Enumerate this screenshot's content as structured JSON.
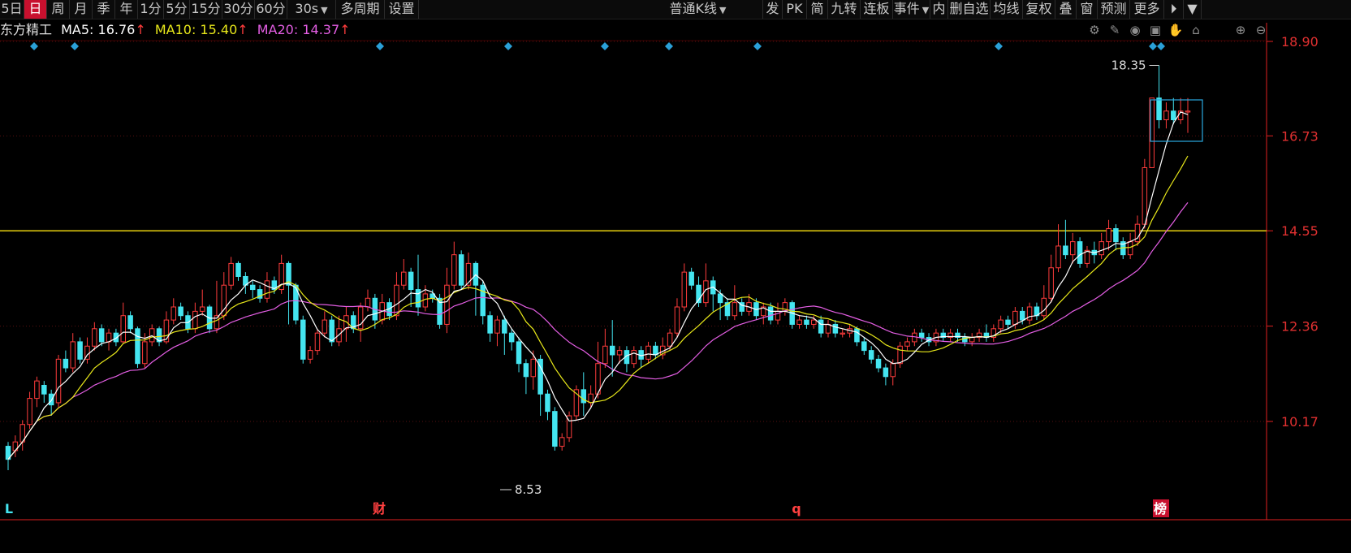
{
  "toolbar": {
    "periods": [
      {
        "label": "5日",
        "active": false
      },
      {
        "label": "日",
        "active": true
      },
      {
        "label": "周",
        "active": false
      },
      {
        "label": "月",
        "active": false
      },
      {
        "label": "季",
        "active": false
      },
      {
        "label": "年",
        "active": false
      },
      {
        "label": "1分",
        "active": false
      },
      {
        "label": "5分",
        "active": false
      },
      {
        "label": "15分",
        "active": false
      },
      {
        "label": "30分",
        "active": false
      },
      {
        "label": "60分",
        "active": false
      },
      {
        "label": "30s",
        "active": false,
        "dropdown": true
      },
      {
        "label": "多周期",
        "active": false
      },
      {
        "label": "设置",
        "active": false
      }
    ],
    "chart_type": "普通K线",
    "right_items": [
      "发",
      "PK",
      "简",
      "九转",
      "连板",
      "事件",
      "内",
      "删自选",
      "均线",
      "复权",
      "叠",
      "窗",
      "预测",
      "更多"
    ]
  },
  "info": {
    "stock_name": "东方精工",
    "ma5_label": "MA5:",
    "ma5_value": "16.76",
    "ma10_label": "MA10:",
    "ma10_value": "15.40",
    "ma20_label": "MA20:",
    "ma20_value": "14.37",
    "arrow": "↑"
  },
  "colors": {
    "up": "#ff3c3c",
    "down": "#44e5f0",
    "ma5": "#ffffff",
    "ma10": "#e8e81a",
    "ma20": "#e45ee4",
    "hline": "#e8d10e",
    "axis": "#e02020",
    "diamond": "#2aa0d8"
  },
  "icons": [
    "gear-icon",
    "pen-icon",
    "eye-icon",
    "briefcase-icon",
    "hand-icon",
    "lock-icon",
    "zoom-in-icon",
    "zoom-out-icon"
  ],
  "markers": {
    "high_label": "18.35",
    "low_label": "8.53"
  },
  "bottom_labels": [
    {
      "text": "L",
      "color": "#44e5f0",
      "bg": null
    },
    {
      "text": "财",
      "color": "#ff4040",
      "bg": null
    },
    {
      "text": "q",
      "color": "#ff4040",
      "bg": null
    },
    {
      "text": "榜",
      "color": "#ffffff",
      "bg": "#c8102e"
    }
  ],
  "chart_data": {
    "type": "candlestick",
    "price_axis": {
      "ticks": [
        "18.90",
        "16.73",
        "14.55",
        "12.36",
        "10.17"
      ],
      "min": 8.3,
      "max": 19.0
    },
    "horizontal_line": 14.55,
    "candles": [
      [
        9.6,
        9.3,
        9.7,
        9.05
      ],
      [
        9.5,
        9.7,
        9.85,
        9.35
      ],
      [
        9.7,
        10.1,
        10.2,
        9.5
      ],
      [
        10.1,
        10.7,
        10.85,
        10.0
      ],
      [
        10.7,
        11.1,
        11.2,
        10.5
      ],
      [
        11.0,
        10.8,
        11.1,
        10.6
      ],
      [
        10.8,
        10.55,
        10.9,
        10.3
      ],
      [
        10.6,
        11.6,
        11.7,
        10.5
      ],
      [
        11.6,
        11.4,
        11.8,
        11.3
      ],
      [
        11.4,
        12.0,
        12.2,
        11.3
      ],
      [
        12.0,
        11.6,
        12.1,
        11.5
      ],
      [
        11.6,
        11.9,
        12.1,
        11.5
      ],
      [
        11.9,
        12.3,
        12.45,
        11.8
      ],
      [
        12.3,
        12.0,
        12.4,
        11.9
      ],
      [
        12.0,
        12.2,
        12.3,
        11.8
      ],
      [
        12.2,
        12.0,
        12.3,
        11.9
      ],
      [
        12.0,
        12.6,
        12.9,
        11.95
      ],
      [
        12.6,
        12.3,
        12.7,
        12.2
      ],
      [
        12.3,
        11.5,
        12.35,
        11.4
      ],
      [
        11.5,
        12.0,
        12.2,
        11.4
      ],
      [
        12.0,
        12.3,
        12.4,
        11.9
      ],
      [
        12.3,
        12.0,
        12.35,
        11.9
      ],
      [
        12.0,
        12.5,
        12.7,
        11.95
      ],
      [
        12.5,
        12.8,
        13.0,
        12.4
      ],
      [
        12.8,
        12.6,
        12.9,
        12.5
      ],
      [
        12.6,
        12.3,
        12.7,
        12.2
      ],
      [
        12.3,
        12.7,
        12.9,
        12.2
      ],
      [
        12.7,
        12.8,
        13.2,
        12.6
      ],
      [
        12.8,
        12.3,
        12.85,
        12.2
      ],
      [
        12.3,
        12.6,
        13.4,
        12.2
      ],
      [
        12.6,
        13.3,
        13.6,
        12.5
      ],
      [
        13.3,
        13.8,
        13.95,
        13.2
      ],
      [
        13.8,
        13.5,
        13.85,
        13.4
      ],
      [
        13.5,
        13.3,
        13.6,
        13.1
      ],
      [
        13.3,
        13.2,
        13.4,
        13.0
      ],
      [
        13.2,
        13.0,
        13.3,
        12.9
      ],
      [
        13.0,
        13.4,
        13.6,
        12.9
      ],
      [
        13.4,
        13.2,
        13.5,
        13.1
      ],
      [
        13.2,
        13.8,
        14.0,
        13.1
      ],
      [
        13.8,
        13.3,
        13.85,
        12.4
      ],
      [
        13.3,
        12.5,
        13.35,
        12.4
      ],
      [
        12.5,
        11.6,
        12.6,
        11.5
      ],
      [
        11.6,
        11.8,
        11.9,
        11.5
      ],
      [
        11.8,
        12.2,
        12.3,
        11.7
      ],
      [
        12.2,
        12.5,
        12.7,
        12.1
      ],
      [
        12.5,
        12.0,
        12.6,
        11.9
      ],
      [
        12.0,
        12.3,
        12.6,
        11.9
      ],
      [
        12.3,
        12.6,
        12.8,
        12.0
      ],
      [
        12.6,
        12.3,
        12.7,
        12.2
      ],
      [
        12.3,
        12.8,
        12.9,
        12.0
      ],
      [
        12.8,
        13.0,
        13.2,
        12.7
      ],
      [
        13.0,
        12.5,
        13.1,
        12.3
      ],
      [
        12.5,
        12.9,
        13.1,
        12.4
      ],
      [
        12.9,
        12.6,
        13.0,
        12.5
      ],
      [
        12.6,
        13.3,
        13.6,
        12.5
      ],
      [
        13.3,
        13.6,
        13.9,
        13.2
      ],
      [
        13.6,
        13.2,
        13.7,
        12.8
      ],
      [
        13.2,
        12.8,
        14.0,
        12.6
      ],
      [
        12.8,
        13.1,
        13.3,
        12.7
      ],
      [
        13.1,
        13.0,
        13.2,
        12.9
      ],
      [
        13.0,
        12.4,
        13.1,
        12.3
      ],
      [
        12.4,
        13.3,
        13.7,
        12.2
      ],
      [
        13.3,
        14.0,
        14.3,
        13.2
      ],
      [
        14.0,
        13.3,
        14.1,
        13.2
      ],
      [
        13.3,
        13.8,
        14.05,
        13.2
      ],
      [
        13.8,
        13.3,
        13.85,
        12.6
      ],
      [
        13.3,
        12.6,
        13.4,
        12.4
      ],
      [
        12.6,
        12.2,
        12.7,
        12.0
      ],
      [
        12.2,
        12.5,
        12.6,
        11.9
      ],
      [
        12.5,
        12.2,
        12.6,
        11.7
      ],
      [
        12.2,
        12.0,
        12.3,
        11.8
      ],
      [
        12.0,
        11.5,
        12.1,
        11.3
      ],
      [
        11.5,
        11.2,
        11.6,
        10.8
      ],
      [
        11.2,
        11.6,
        11.8,
        10.9
      ],
      [
        11.6,
        10.8,
        11.7,
        10.3
      ],
      [
        10.8,
        10.4,
        10.9,
        10.2
      ],
      [
        10.4,
        9.6,
        10.5,
        9.5
      ],
      [
        9.6,
        9.8,
        9.9,
        9.5
      ],
      [
        9.8,
        10.3,
        10.4,
        9.7
      ],
      [
        10.3,
        10.9,
        11.0,
        10.2
      ],
      [
        10.9,
        10.6,
        11.3,
        10.3
      ],
      [
        10.6,
        10.8,
        11.0,
        10.5
      ],
      [
        10.8,
        11.5,
        12.0,
        10.7
      ],
      [
        11.5,
        11.9,
        12.3,
        11.4
      ],
      [
        11.9,
        11.7,
        12.5,
        11.2
      ],
      [
        11.7,
        11.8,
        11.9,
        11.5
      ],
      [
        11.8,
        11.5,
        11.9,
        11.3
      ],
      [
        11.5,
        11.8,
        11.9,
        11.4
      ],
      [
        11.8,
        11.6,
        11.9,
        11.4
      ],
      [
        11.6,
        11.9,
        12.0,
        11.5
      ],
      [
        11.9,
        11.7,
        12.0,
        11.6
      ],
      [
        11.7,
        11.9,
        12.1,
        11.6
      ],
      [
        11.9,
        12.2,
        12.3,
        11.8
      ],
      [
        12.2,
        12.8,
        13.0,
        12.1
      ],
      [
        12.8,
        13.6,
        13.8,
        12.7
      ],
      [
        13.6,
        13.3,
        13.7,
        13.2
      ],
      [
        13.3,
        12.9,
        13.5,
        12.8
      ],
      [
        12.9,
        13.4,
        13.8,
        12.8
      ],
      [
        13.4,
        13.1,
        13.5,
        12.7
      ],
      [
        13.1,
        12.9,
        13.2,
        12.5
      ],
      [
        12.9,
        12.6,
        13.0,
        12.5
      ],
      [
        12.6,
        12.9,
        13.3,
        12.5
      ],
      [
        12.9,
        12.7,
        13.0,
        12.6
      ],
      [
        12.7,
        12.9,
        13.1,
        12.6
      ],
      [
        12.9,
        12.6,
        13.0,
        12.5
      ],
      [
        12.6,
        12.8,
        12.9,
        12.4
      ],
      [
        12.8,
        12.5,
        12.9,
        12.4
      ],
      [
        12.5,
        12.7,
        12.9,
        12.4
      ],
      [
        12.7,
        12.9,
        13.0,
        12.6
      ],
      [
        12.9,
        12.4,
        12.95,
        12.3
      ],
      [
        12.4,
        12.5,
        12.6,
        12.3
      ],
      [
        12.5,
        12.4,
        12.6,
        12.3
      ],
      [
        12.4,
        12.5,
        12.6,
        12.3
      ],
      [
        12.5,
        12.2,
        12.6,
        12.1
      ],
      [
        12.2,
        12.4,
        12.5,
        12.1
      ],
      [
        12.4,
        12.2,
        12.5,
        12.1
      ],
      [
        12.2,
        12.2,
        12.3,
        12.1
      ],
      [
        12.2,
        12.3,
        12.4,
        12.1
      ],
      [
        12.3,
        12.0,
        12.35,
        11.9
      ],
      [
        12.0,
        11.8,
        12.1,
        11.7
      ],
      [
        11.8,
        11.6,
        11.9,
        11.5
      ],
      [
        11.6,
        11.4,
        11.7,
        11.3
      ],
      [
        11.4,
        11.2,
        11.5,
        11.0
      ],
      [
        11.2,
        11.5,
        11.6,
        11.0
      ],
      [
        11.5,
        11.9,
        12.0,
        11.4
      ],
      [
        11.9,
        12.0,
        12.1,
        11.8
      ],
      [
        12.0,
        12.2,
        12.3,
        11.9
      ],
      [
        12.2,
        12.1,
        12.3,
        12.0
      ],
      [
        12.1,
        12.0,
        12.2,
        11.9
      ],
      [
        12.0,
        12.2,
        12.3,
        11.9
      ],
      [
        12.2,
        12.1,
        12.3,
        12.0
      ],
      [
        12.1,
        12.2,
        12.3,
        12.0
      ],
      [
        12.2,
        12.1,
        12.3,
        12.0
      ],
      [
        12.1,
        12.0,
        12.2,
        11.9
      ],
      [
        12.0,
        12.1,
        12.2,
        11.9
      ],
      [
        12.1,
        12.2,
        12.3,
        12.0
      ],
      [
        12.2,
        12.1,
        12.4,
        12.0
      ],
      [
        12.1,
        12.3,
        12.4,
        12.0
      ],
      [
        12.3,
        12.5,
        12.6,
        12.2
      ],
      [
        12.5,
        12.4,
        12.6,
        12.3
      ],
      [
        12.4,
        12.7,
        12.8,
        12.3
      ],
      [
        12.7,
        12.5,
        12.8,
        12.4
      ],
      [
        12.5,
        12.8,
        12.9,
        12.4
      ],
      [
        12.8,
        12.6,
        12.9,
        12.5
      ],
      [
        12.6,
        13.0,
        13.3,
        12.5
      ],
      [
        13.0,
        13.7,
        14.0,
        12.9
      ],
      [
        13.7,
        14.2,
        14.7,
        13.6
      ],
      [
        14.2,
        14.0,
        14.8,
        13.9
      ],
      [
        14.0,
        14.3,
        14.5,
        13.8
      ],
      [
        14.3,
        13.8,
        14.4,
        13.7
      ],
      [
        13.8,
        14.1,
        14.2,
        13.7
      ],
      [
        14.1,
        14.0,
        14.3,
        13.8
      ],
      [
        14.0,
        14.3,
        14.5,
        13.9
      ],
      [
        14.3,
        14.6,
        14.8,
        14.1
      ],
      [
        14.6,
        14.3,
        14.7,
        14.1
      ],
      [
        14.3,
        14.0,
        14.4,
        13.9
      ],
      [
        14.0,
        14.3,
        14.5,
        13.9
      ],
      [
        14.3,
        14.7,
        14.9,
        14.2
      ],
      [
        14.7,
        16.0,
        16.2,
        14.6
      ],
      [
        16.0,
        17.6,
        17.6,
        16.0
      ],
      [
        17.6,
        17.1,
        18.35,
        16.9
      ],
      [
        17.1,
        17.3,
        17.5,
        16.9
      ],
      [
        17.3,
        17.1,
        17.6,
        17.0
      ],
      [
        17.1,
        17.3,
        17.6,
        17.0
      ],
      [
        17.3,
        17.3,
        17.6,
        16.8
      ]
    ]
  }
}
